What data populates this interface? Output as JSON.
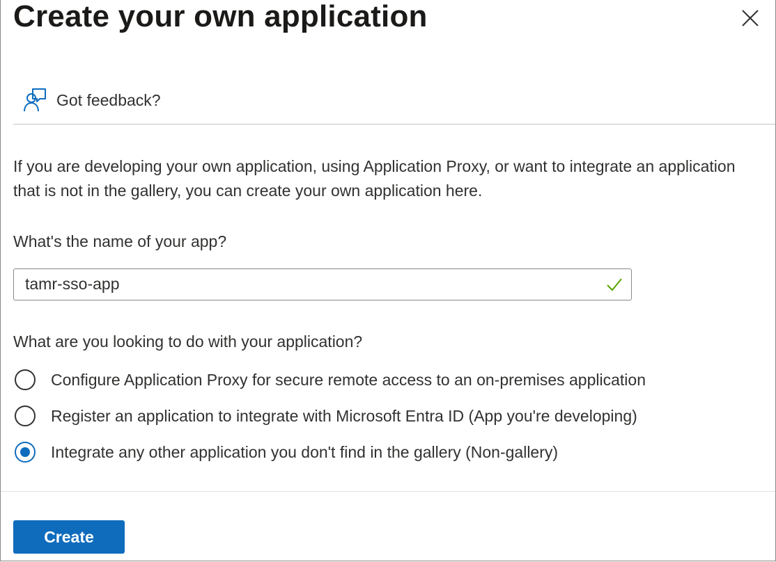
{
  "dialog": {
    "title": "Create your own application",
    "close_icon": "close-icon"
  },
  "feedback": {
    "icon": "feedback-person-icon",
    "label": "Got feedback?"
  },
  "description": "If you are developing your own application, using Application Proxy, or want to integrate an application that is not in the gallery, you can create your own application here.",
  "app_name": {
    "label": "What's the name of your app?",
    "value": "tamr-sso-app",
    "valid_icon": "checkmark-icon",
    "valid_color": "#57a300"
  },
  "purpose": {
    "label": "What are you looking to do with your application?",
    "options": [
      {
        "label": "Configure Application Proxy for secure remote access to an on-premises application",
        "selected": false
      },
      {
        "label": "Register an application to integrate with Microsoft Entra ID (App you're developing)",
        "selected": false
      },
      {
        "label": "Integrate any other application you don't find in the gallery (Non-gallery)",
        "selected": true
      }
    ]
  },
  "footer": {
    "create_label": "Create"
  },
  "colors": {
    "accent": "#0f6cbd",
    "text": "#323130",
    "border": "#8a8886"
  }
}
